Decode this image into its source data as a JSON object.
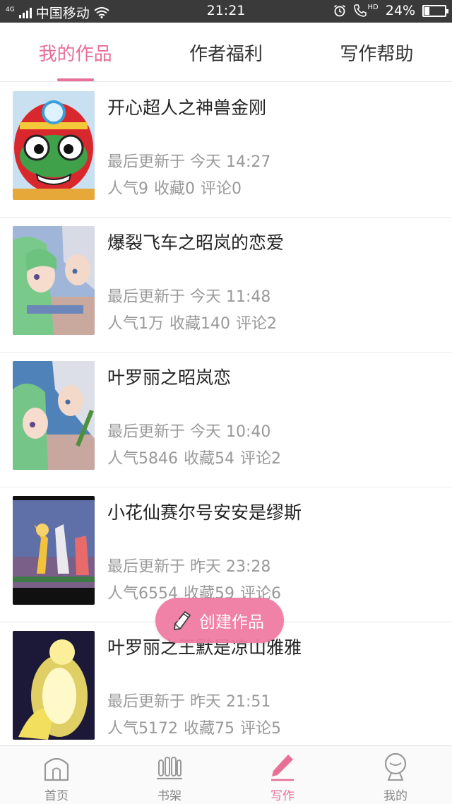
{
  "status_bar": {
    "network": "4G",
    "carrier": "中国移动",
    "time": "21:21",
    "hd": "HD",
    "battery": "24%",
    "battery_level": 0.24
  },
  "tabs": [
    {
      "label": "我的作品",
      "active": true
    },
    {
      "label": "作者福利",
      "active": false
    },
    {
      "label": "写作帮助",
      "active": false
    }
  ],
  "works": [
    {
      "title": "开心超人之神兽金刚",
      "updated": "最后更新于 今天 14:27",
      "popularity": "人气9",
      "favorites": "收藏0",
      "comments": "评论0"
    },
    {
      "title": "爆裂飞车之昭岚的恋爱",
      "updated": "最后更新于 今天 11:48",
      "popularity": "人气1万",
      "favorites": "收藏140",
      "comments": "评论2"
    },
    {
      "title": "叶罗丽之昭岚恋",
      "updated": "最后更新于 今天 10:40",
      "popularity": "人气5846",
      "favorites": "收藏54",
      "comments": "评论2"
    },
    {
      "title": "小花仙赛尔号安安是缪斯",
      "updated": "最后更新于 昨天 23:28",
      "popularity": "人气6554",
      "favorites": "收藏59",
      "comments": "评论6"
    },
    {
      "title": "叶罗丽之王默是凉山雅雅",
      "updated": "最后更新于 昨天 21:51",
      "popularity": "人气5172",
      "favorites": "收藏75",
      "comments": "评论5"
    }
  ],
  "create_button": {
    "label": "创建作品",
    "icon": "pencil-icon"
  },
  "bottom_nav": [
    {
      "label": "首页",
      "icon": "home-icon",
      "active": false
    },
    {
      "label": "书架",
      "icon": "bookshelf-icon",
      "active": false
    },
    {
      "label": "写作",
      "icon": "pen-icon",
      "active": true
    },
    {
      "label": "我的",
      "icon": "profile-icon",
      "active": false
    }
  ],
  "colors": {
    "accent": "#e86f96",
    "status_bar": "#3a3a3a",
    "muted_text": "#999999"
  }
}
